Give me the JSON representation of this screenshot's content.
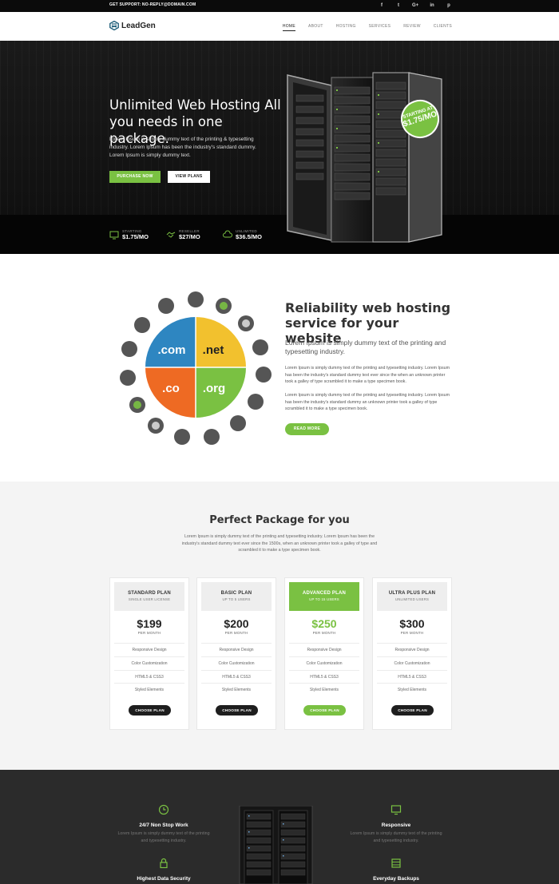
{
  "topbar": {
    "support": "GET SUPPORT: NO-REPLY@DOMAIN.COM",
    "socials": [
      "f",
      "t",
      "G+",
      "in",
      "p"
    ]
  },
  "nav": {
    "logo": "LeadGen",
    "items": [
      "HOME",
      "ABOUT",
      "HOSTING",
      "SERVICES",
      "REVIEW",
      "CLIENTS"
    ]
  },
  "hero": {
    "title": "Unlimited Web Hosting All you needs in one package.",
    "text": "Lorem Ipsum is simply dummy text of the printing & typesetting industry. Lorem Ipsum has been the industry's standard dummy. Lorem Ipsum is simply dummy text.",
    "primary_button": "PURCHASE NOW",
    "secondary_button": "VIEW PLANS",
    "badge_label": "STARTING AT",
    "badge_price": "$1.75/MO",
    "stats": [
      {
        "label": "STARTING",
        "value": "$1.75/MO",
        "icon": "monitor-icon"
      },
      {
        "label": "RESELLER",
        "value": "$27/MO",
        "icon": "handshake-icon"
      },
      {
        "label": "UNLIMITED",
        "value": "$36.5/MO",
        "icon": "cloud-icon"
      }
    ]
  },
  "reliability": {
    "title": "Reliability web hosting service for your website",
    "lead": "Lorem Ipsum is simply dummy text of the printing and typesetting industry.",
    "p1": "Lorem Ipsum is simply dummy text of the printing and typesetting industry. Lorem Ipsum has been the industry's standard dummy text ever since the when an unknown printer took a galley of type scrambled it to make a type specimen book.",
    "p2": "Lorem Ipsum is simply dummy text of the printing and typesetting industry. Lorem Ipsum has been the industry's standard dummy an unknown printer took a galley of type scrambled it to make a type specimen book.",
    "button": "READ MORE",
    "domains": [
      ".com",
      ".net",
      ".co",
      ".org"
    ],
    "domain_colors": [
      "#2e86c1",
      "#f2c12e",
      "#ee6a23",
      "#7ac142"
    ]
  },
  "pricing": {
    "title": "Perfect Package for you",
    "desc": "Lorem Ipsum is simply dummy text of the printing and typesetting industry. Lorem Ipsum has been the industry's standard dummy text ever since the 1500s, when an unknown printer took a galley of type and scrambled it to make a type specimen book.",
    "plans": [
      {
        "name": "STANDARD PLAN",
        "sub": "SINGLE USER LICENSE",
        "price": "$199",
        "per": "PER MONTH",
        "features": [
          "Responsive Design",
          "Color Customization",
          "HTML5 & CSS3",
          "Styled Elements"
        ],
        "button": "CHOOSE PLAN"
      },
      {
        "name": "BASIC PLAN",
        "sub": "UP TO 5 USERS",
        "price": "$200",
        "per": "PER MONTH",
        "features": [
          "Responsive Design",
          "Color Customization",
          "HTML5 & CSS3",
          "Styled Elements"
        ],
        "button": "CHOOSE PLAN"
      },
      {
        "name": "ADVANCED PLAN",
        "sub": "UP TO 15 USERS",
        "price": "$250",
        "per": "PER MONTH",
        "features": [
          "Responsive Design",
          "Color Customization",
          "HTML5 & CSS3",
          "Styled Elements"
        ],
        "button": "CHOOSE PLAN"
      },
      {
        "name": "ULTRA PLUS PLAN",
        "sub": "UNLIMITED USERS",
        "price": "$300",
        "per": "PER MONTH",
        "features": [
          "Responsive Design",
          "Color Customization",
          "HTML5 & CSS3",
          "Styled Elements"
        ],
        "button": "CHOOSE PLAN"
      }
    ]
  },
  "features": {
    "items": [
      {
        "title": "24/7 Non Stop Work",
        "desc": "Lorem Ipsum is simply dummy text of the printing and typesetting industry.",
        "icon": "clock-icon"
      },
      {
        "title": "Responsive",
        "desc": "Lorem Ipsum is simply dummy text of the printing and typesetting industry.",
        "icon": "monitor-icon"
      },
      {
        "title": "Highest Data Security",
        "desc": "",
        "icon": "lock-icon"
      },
      {
        "title": "Everyday Backups",
        "desc": "",
        "icon": "database-icon"
      }
    ]
  },
  "colors": {
    "accent": "#7ac142",
    "dark": "#0b0b0b"
  }
}
